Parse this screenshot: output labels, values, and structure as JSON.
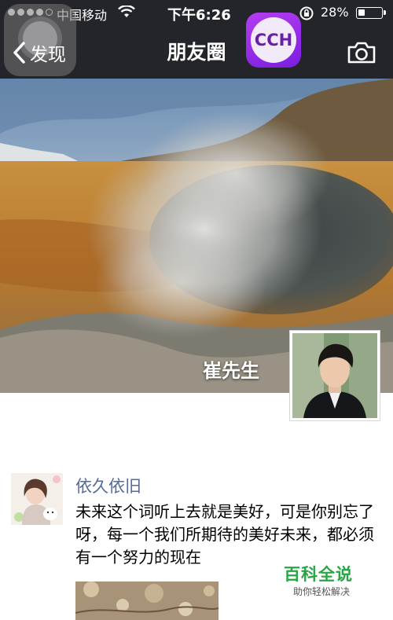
{
  "status_bar": {
    "carrier": "中国移动",
    "time": "下午6:26",
    "battery": "28%",
    "battery_level": 0.28
  },
  "nav": {
    "back_label": "发现",
    "title": "朋友圈",
    "logo_text": "CCH"
  },
  "cover": {
    "owner_name": "崔先生"
  },
  "post": {
    "author": "依久依旧",
    "text": "未来这个词听上去就是美好，可是你别忘了呀，每一个我们所期待的美好未来，都必须有一个努力的现在"
  },
  "watermark": {
    "main": "百科全说",
    "sub": "助你轻松解决"
  },
  "colors": {
    "nav_bg": "#24252a",
    "author_link": "#576b95",
    "watermark_green": "#27a644"
  }
}
